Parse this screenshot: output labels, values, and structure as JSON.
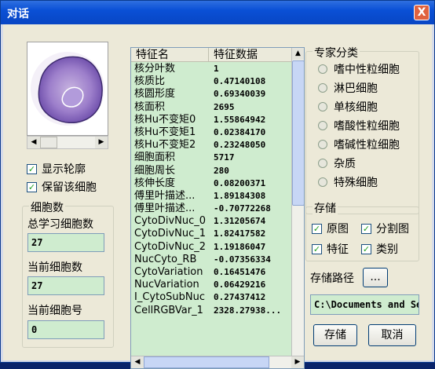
{
  "window": {
    "title": "对话",
    "close_label": "X"
  },
  "options": {
    "show_contour": "显示轮廓",
    "keep_cell": "保留该细胞"
  },
  "cell_count": {
    "group_label": "细胞数",
    "total_label": "总学习细胞数",
    "total_value": "27",
    "current_label": "当前细胞数",
    "current_value": "27",
    "index_label": "当前细胞号",
    "index_value": "0"
  },
  "features": {
    "header_name": "特征名",
    "header_value": "特征数据",
    "rows": [
      {
        "name": "核分叶数",
        "value": "1"
      },
      {
        "name": "核质比",
        "value": "0.47140108"
      },
      {
        "name": "核圆形度",
        "value": "0.69340039"
      },
      {
        "name": "核面积",
        "value": "2695"
      },
      {
        "name": "核Hu不变矩0",
        "value": "1.55864942"
      },
      {
        "name": "核Hu不变矩1",
        "value": "0.02384170"
      },
      {
        "name": "核Hu不变矩2",
        "value": "0.23248050"
      },
      {
        "name": "细胞面积",
        "value": "5717"
      },
      {
        "name": "细胞周长",
        "value": "280"
      },
      {
        "name": "核伸长度",
        "value": "0.08200371"
      },
      {
        "name": "傅里叶描述...",
        "value": "1.89184308"
      },
      {
        "name": "傅里叶描述...",
        "value": "-0.70772268"
      },
      {
        "name": "CytoDivNuc_0",
        "value": "1.31205674"
      },
      {
        "name": "CytoDivNuc_1",
        "value": "1.82417582"
      },
      {
        "name": "CytoDivNuc_2",
        "value": "1.19186047"
      },
      {
        "name": "NucCyto_RB",
        "value": "-0.07356334"
      },
      {
        "name": "CytoVariation",
        "value": "0.16451476"
      },
      {
        "name": "NucVariation",
        "value": "0.06429216"
      },
      {
        "name": "I_CytoSubNuc",
        "value": "0.27437412"
      },
      {
        "name": "CellRGBVar_1",
        "value": "2328.27938..."
      }
    ]
  },
  "expert": {
    "group_label": "专家分类",
    "options": [
      "嗜中性粒细胞",
      "淋巴细胞",
      "单核细胞",
      "嗜酸性粒细胞",
      "嗜碱性粒细胞",
      "杂质",
      "特殊细胞"
    ]
  },
  "storage": {
    "group_label": "存储",
    "original": "原图",
    "segmented": "分割图",
    "feature": "特征",
    "category": "类别",
    "path_label": "存储路径",
    "browse_label": "...",
    "path_value": "C:\\Documents and Se",
    "save_button": "存储",
    "cancel_button": "取消"
  },
  "colors": {
    "field_bg": "#cfeccf",
    "title_bar": "#0a50d6"
  }
}
